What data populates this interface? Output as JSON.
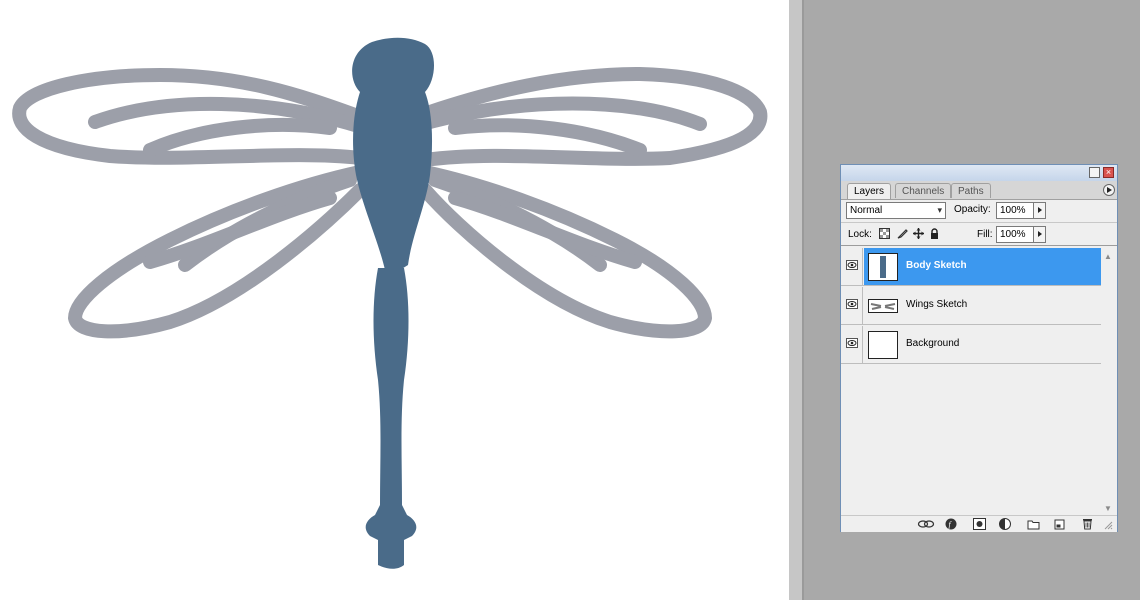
{
  "panel": {
    "tabs": [
      "Layers",
      "Channels",
      "Paths"
    ],
    "blend_mode": "Normal",
    "opacity_label": "Opacity:",
    "opacity_value": "100%",
    "lock_label": "Lock:",
    "fill_label": "Fill:",
    "fill_value": "100%",
    "layers": [
      {
        "name": "Body Sketch",
        "selected": true,
        "visible": true
      },
      {
        "name": "Wings Sketch",
        "selected": false,
        "visible": true
      },
      {
        "name": "Background",
        "selected": false,
        "visible": true
      }
    ],
    "footer_icons": [
      "link-layers-icon",
      "layer-style-icon",
      "layer-mask-icon",
      "adjustment-layer-icon",
      "new-group-icon",
      "new-layer-icon",
      "delete-layer-icon"
    ]
  },
  "colors": {
    "body": "#4a6b89",
    "wings": "#9c9fa9",
    "selection": "#3c98ef",
    "workspace": "#a9a9a9"
  }
}
